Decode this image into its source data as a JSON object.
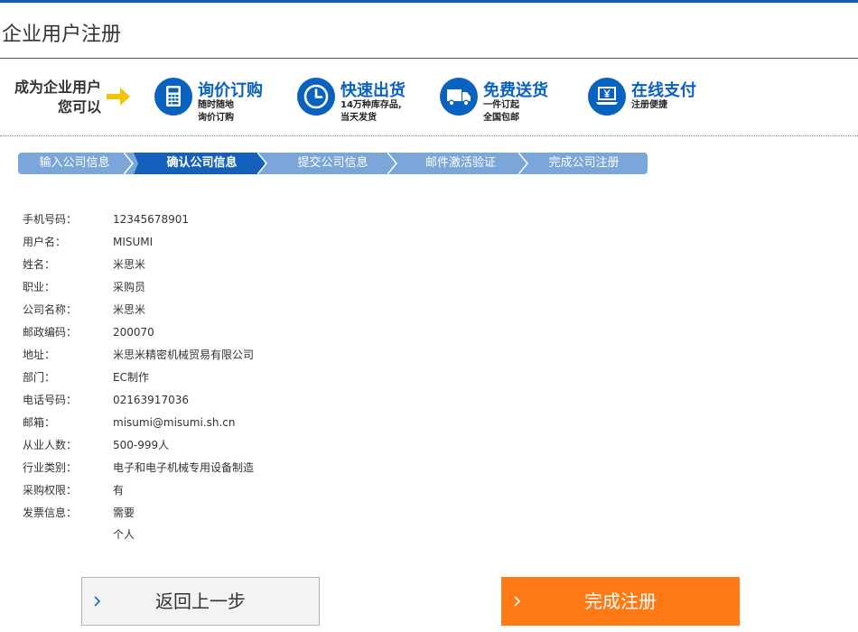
{
  "page": {
    "title": "企业用户注册"
  },
  "banner": {
    "become_line1": "成为企业用户",
    "become_line2": "您可以",
    "features": [
      {
        "icon": "calculator-icon",
        "title": "询价订购",
        "sub1": "随时随地",
        "sub2": "询价订购"
      },
      {
        "icon": "clock-icon",
        "title": "快速出货",
        "sub1": "14万种库存品,",
        "sub2": "当天发货"
      },
      {
        "icon": "truck-icon",
        "title": "免费送货",
        "sub1": "一件订起",
        "sub2": "全国包邮"
      },
      {
        "icon": "laptop-yen-icon",
        "title": "在线支付",
        "sub1": "注册便捷",
        "sub2": ""
      }
    ]
  },
  "steps": {
    "items": [
      {
        "label": "输入公司信息",
        "active": false
      },
      {
        "label": "确认公司信息",
        "active": true
      },
      {
        "label": "提交公司信息",
        "active": false
      },
      {
        "label": "邮件激活验证",
        "active": false
      },
      {
        "label": "完成公司注册",
        "active": false
      }
    ]
  },
  "details": [
    {
      "label": "手机号码：",
      "value": "12345678901"
    },
    {
      "label": "用户名：",
      "value": "MISUMI"
    },
    {
      "label": "姓名：",
      "value": "米思米"
    },
    {
      "label": "职业：",
      "value": "采购员"
    },
    {
      "label": "公司名称：",
      "value": "米思米"
    },
    {
      "label": "邮政编码：",
      "value": "200070"
    },
    {
      "label": "地址：",
      "value": "米思米精密机械贸易有限公司"
    },
    {
      "label": "部门：",
      "value": "EC制作"
    },
    {
      "label": "电话号码：",
      "value": "02163917036"
    },
    {
      "label": "邮箱：",
      "value": "misumi@misumi.sh.cn"
    },
    {
      "label": "从业人数：",
      "value": "500-999人"
    },
    {
      "label": "行业类别：",
      "value": "电子和电子机械专用设备制造"
    },
    {
      "label": "采购权限：",
      "value": "有"
    },
    {
      "label": "发票信息：",
      "value": "需要",
      "value2": "个人"
    }
  ],
  "buttons": {
    "back_label": "返回上一步",
    "finish_label": "完成注册"
  },
  "colors": {
    "brand_blue": "#0a62c0",
    "step_inactive": "#7ba6d9",
    "step_active": "#1560bd",
    "finish_orange": "#ff7a14",
    "arrow_yellow": "#f5c400"
  }
}
